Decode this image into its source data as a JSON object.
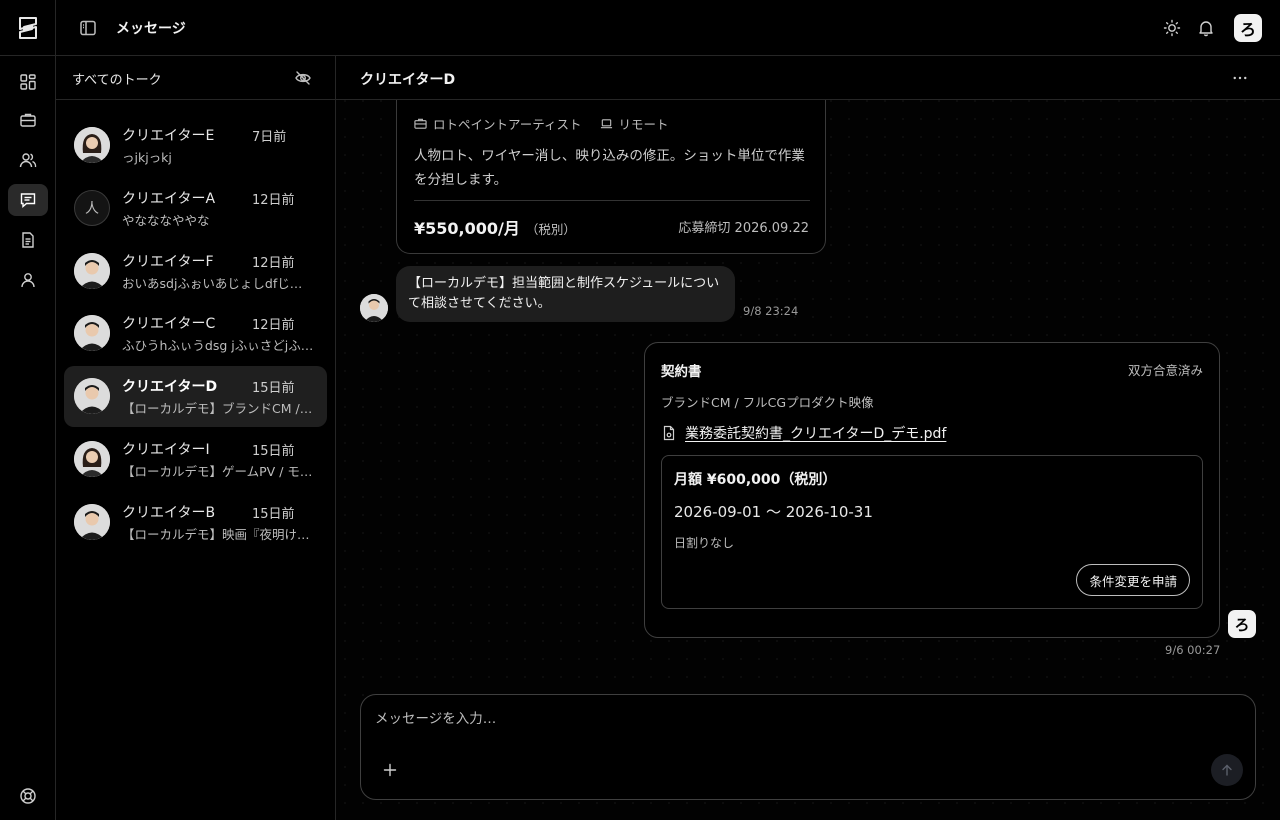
{
  "header": {
    "title": "メッセージ",
    "brand_glyph": "ろ"
  },
  "rail": {
    "items": [
      {
        "icon": "dashboard-icon"
      },
      {
        "icon": "briefcase-icon"
      },
      {
        "icon": "users-icon"
      },
      {
        "icon": "chat-icon",
        "active": true
      },
      {
        "icon": "document-icon"
      },
      {
        "icon": "user-icon"
      }
    ],
    "bottom_icon": "help-icon"
  },
  "conversations": {
    "title": "すべてのトーク",
    "items": [
      {
        "name": "クリエイターE",
        "time": "7日前",
        "preview": "っjkjっkj",
        "avatar": "female"
      },
      {
        "name": "クリエイターA",
        "time": "12日前",
        "preview": "やなななややな",
        "avatar": "placeholder",
        "avatar_glyph": "人"
      },
      {
        "name": "クリエイターF",
        "time": "12日前",
        "preview": "おいあsdjふぉいあじょしdfじゃ…",
        "avatar": "male"
      },
      {
        "name": "クリエイターC",
        "time": "12日前",
        "preview": "ふひうhふぃうdsg jふぃさどjふ…",
        "avatar": "male"
      },
      {
        "name": "クリエイターD",
        "time": "15日前",
        "preview": "【ローカルデモ】ブランドCM / フ…",
        "avatar": "male",
        "active": true
      },
      {
        "name": "クリエイターI",
        "time": "15日前",
        "preview": "【ローカルデモ】ゲームPV / モー…",
        "avatar": "female"
      },
      {
        "name": "クリエイターB",
        "time": "15日前",
        "preview": "【ローカルデモ】映画『夜明けの…",
        "avatar": "male"
      }
    ]
  },
  "chat": {
    "title": "クリエイターD",
    "job": {
      "role": "ロトペイントアーティスト",
      "location": "リモート",
      "description": "人物ロト、ワイヤー消し、映り込みの修正。ショット単位で作業を分担します。",
      "price": "¥550,000/月",
      "tax": "（税別）",
      "deadline": "応募締切 2026.09.22"
    },
    "message": {
      "text": "【ローカルデモ】担当範囲と制作スケジュールについて相談させてください。",
      "time": "9/8 23:24"
    },
    "contract": {
      "title": "契約書",
      "status": "双方合意済み",
      "project": "ブランドCM / フルCGプロダクト映像",
      "file": "業務委託契約書_クリエイターD_デモ.pdf",
      "amount": "月額 ¥600,000（税別）",
      "period": "2026-09-01 〜 2026-10-31",
      "note": "日割りなし",
      "button": "条件変更を申請",
      "time": "9/6 00:27"
    },
    "composer": {
      "placeholder": "メッセージを入力…"
    }
  }
}
